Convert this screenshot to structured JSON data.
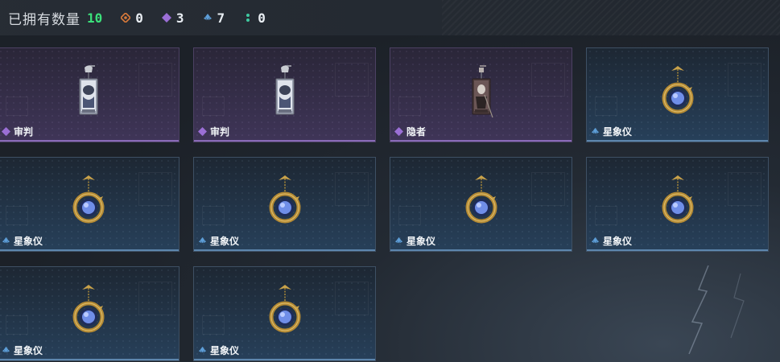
{
  "header": {
    "owned_label": "已拥有数量",
    "owned_count": "10",
    "stats": [
      {
        "icon": "orange-diamond-icon",
        "color": "#d97a3a",
        "value": "0"
      },
      {
        "icon": "purple-diamond-icon",
        "color": "#9b6fd6",
        "value": "3"
      },
      {
        "icon": "blue-triangle-icon",
        "color": "#5d9ed8",
        "value": "7"
      },
      {
        "icon": "green-dots-icon",
        "color": "#3fc9a0",
        "value": "0"
      }
    ]
  },
  "items": [
    {
      "name": "审判",
      "rarity": "purple",
      "art": "tarot-card-judgement"
    },
    {
      "name": "审判",
      "rarity": "purple",
      "art": "tarot-card-judgement"
    },
    {
      "name": "隐者",
      "rarity": "purple",
      "art": "tarot-card-hermit"
    },
    {
      "name": "星象仪",
      "rarity": "blue",
      "art": "astrolabe-pendant"
    },
    {
      "name": "星象仪",
      "rarity": "blue",
      "art": "astrolabe-pendant"
    },
    {
      "name": "星象仪",
      "rarity": "blue",
      "art": "astrolabe-pendant"
    },
    {
      "name": "星象仪",
      "rarity": "blue",
      "art": "astrolabe-pendant"
    },
    {
      "name": "星象仪",
      "rarity": "blue",
      "art": "astrolabe-pendant"
    },
    {
      "name": "星象仪",
      "rarity": "blue",
      "art": "astrolabe-pendant"
    },
    {
      "name": "星象仪",
      "rarity": "blue",
      "art": "astrolabe-pendant"
    }
  ]
}
